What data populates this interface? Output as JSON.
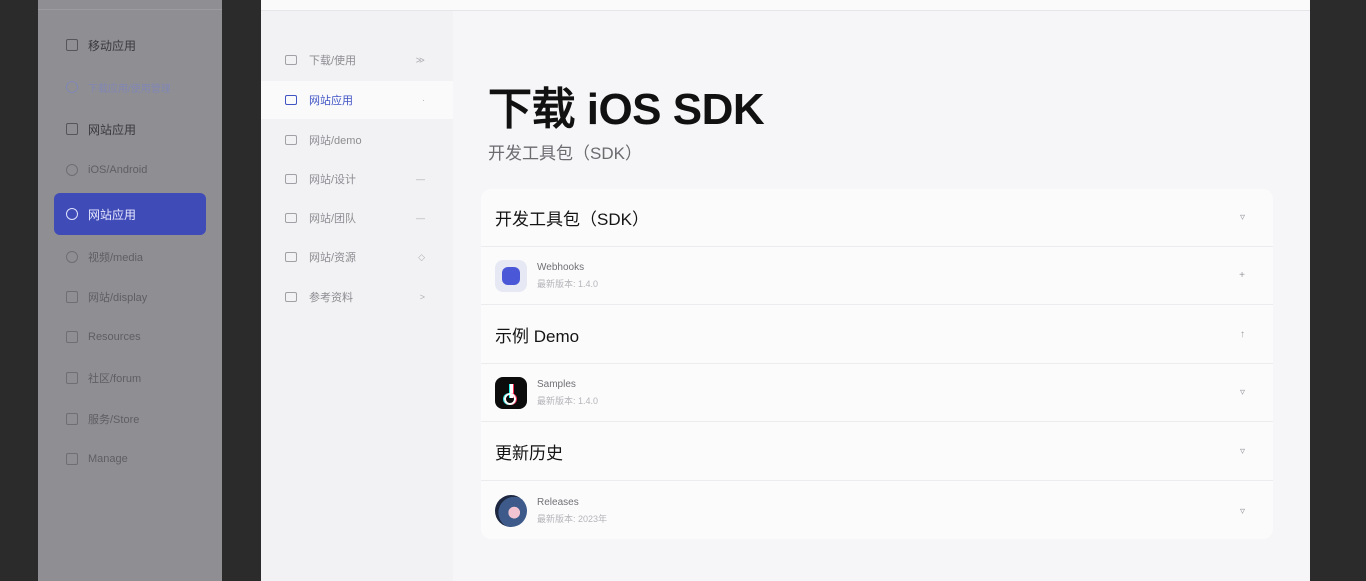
{
  "left_app": {
    "items": [
      {
        "label": "移动应用",
        "icon": "grid-icon"
      },
      {
        "label": "下载应用/使用管理",
        "icon": "clock-icon"
      },
      {
        "label": "网站应用",
        "icon": "doc-icon"
      },
      {
        "label": "iOS/Android",
        "icon": "globe-icon"
      },
      {
        "label": "网站应用",
        "icon": "cloud-icon"
      },
      {
        "label": "视频/media",
        "icon": "circle-icon"
      },
      {
        "label": "网站/display",
        "icon": "list-icon"
      },
      {
        "label": "Resources",
        "icon": "box-icon"
      },
      {
        "label": "社区/forum",
        "icon": "book-icon"
      },
      {
        "label": "服务/Store",
        "icon": "bag-icon"
      },
      {
        "label": "Manage",
        "icon": "lock-icon"
      }
    ]
  },
  "sub_nav": {
    "items": [
      {
        "label": "下载/使用",
        "icon": "store-icon",
        "chev": "≫"
      },
      {
        "label": "网站应用",
        "icon": "monitor-icon",
        "chev": "·"
      },
      {
        "label": "网站/demo",
        "icon": "window-icon",
        "chev": ""
      },
      {
        "label": "网站/设计",
        "icon": "image-icon",
        "chev": "—"
      },
      {
        "label": "网站/团队",
        "icon": "stack-icon",
        "chev": "—"
      },
      {
        "label": "网站/资源",
        "icon": "layers-icon",
        "chev": "◇"
      },
      {
        "label": "参考资料",
        "icon": "panel-icon",
        "chev": ">"
      }
    ]
  },
  "page": {
    "title": "下载 iOS SDK",
    "subtitle": "开发工具包（SDK）"
  },
  "sections": [
    {
      "heading": "开发工具包（SDK）",
      "toggle": "▿",
      "item": {
        "name": "Webhooks",
        "desc": "最新版本: 1.4.0",
        "icon": "sdk-app-icon",
        "toggle": "+"
      }
    },
    {
      "heading": "示例 Demo",
      "toggle": "↑",
      "item": {
        "name": "Samples",
        "desc": "最新版本: 1.4.0",
        "icon": "tiktok-icon",
        "toggle": "▿"
      }
    },
    {
      "heading": "更新历史",
      "toggle": "▿",
      "item": {
        "name": "Releases",
        "desc": "最新版本: 2023年",
        "icon": "avatar-icon",
        "toggle": "▿"
      }
    }
  ],
  "colors": {
    "accent": "#3f4bb7",
    "active_text": "#4054c4"
  }
}
